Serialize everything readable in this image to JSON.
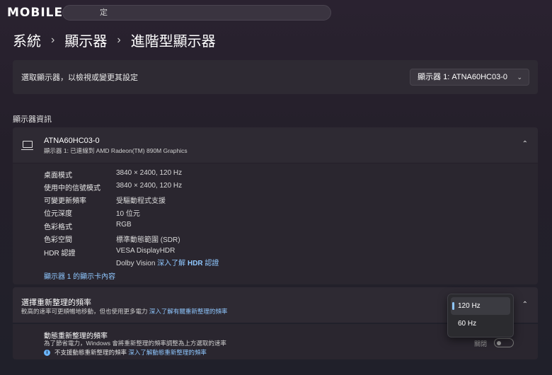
{
  "watermark": {
    "text": "MOBILE",
    "logo": "mobile01-logo"
  },
  "search": {
    "value": "定"
  },
  "breadcrumb": {
    "items": [
      "系統",
      "顯示器",
      "進階型顯示器"
    ],
    "separator": "›"
  },
  "select_display": {
    "label": "選取顯示器，以檢視或變更其設定",
    "selected": "顯示器 1: ATNA60HC03-0"
  },
  "section_title": "顯示器資訊",
  "display_info": {
    "name": "ATNA60HC03-0",
    "subtitle": "顯示器 1: 已連線到 AMD Radeon(TM) 890M Graphics",
    "properties": [
      {
        "label": "桌面模式",
        "value": "3840 × 2400, 120 Hz"
      },
      {
        "label": "使用中的信號模式",
        "value": "3840 × 2400, 120 Hz"
      },
      {
        "label": "可變更新頻率",
        "value": "受驅動程式支援"
      },
      {
        "label": "位元深度",
        "value": "10 位元"
      },
      {
        "label": "色彩格式",
        "value": "RGB"
      },
      {
        "label": "色彩空間",
        "value": "標準動態範圍 (SDR)"
      },
      {
        "label": "HDR 認證",
        "value": "VESA DisplayHDR"
      }
    ],
    "dolby_text": "Dolby Vision",
    "hdr_link_prefix": "深入了解",
    "hdr_link_bold": "HDR",
    "hdr_link_suffix": "認證",
    "adapter_link": "顯示器 1 的顯示卡內容"
  },
  "refresh_rate": {
    "title": "選擇重新整理的頻率",
    "desc": "較高的速率可更順暢地移動，但也使用更多電力",
    "desc_link": "深入了解有關重新整理的頻率",
    "options": [
      "120 Hz",
      "60 Hz"
    ],
    "selected": "120 Hz"
  },
  "dynamic_refresh": {
    "title": "動態重新整理的頻率",
    "desc": "為了節省電力，Windows 會將重新整理的頻率調整為上方選取的速率",
    "note": "不支援動態重新整理的頻率",
    "note_link": "深入了解動態重新整理的頻率",
    "toggle_label": "關閉",
    "toggle_state": "off"
  },
  "colors": {
    "accent": "#8fc7ff",
    "card": "#2e2a33",
    "background": "#241f2a"
  }
}
